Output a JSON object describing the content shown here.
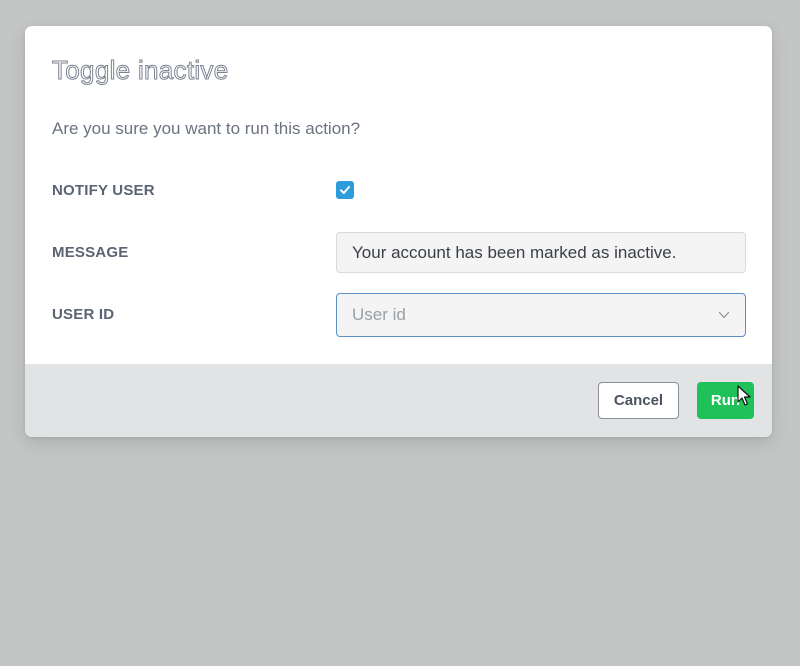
{
  "dialog": {
    "title": "Toggle inactive",
    "subtitle": "Are you sure you want to run this action?",
    "fields": {
      "notify_user": {
        "label": "NOTIFY USER",
        "checked": true
      },
      "message": {
        "label": "MESSAGE",
        "value": "Your account has been marked as inactive."
      },
      "user_id": {
        "label": "USER ID",
        "placeholder": "User id",
        "icon": "chevron-down-icon"
      }
    },
    "buttons": {
      "cancel": "Cancel",
      "run": "Run"
    }
  },
  "colors": {
    "backdrop": "#c4c6c5",
    "accent_blue": "#2d9cdb",
    "run_green": "#21c15a",
    "footer_bg": "#e1e3e5"
  }
}
